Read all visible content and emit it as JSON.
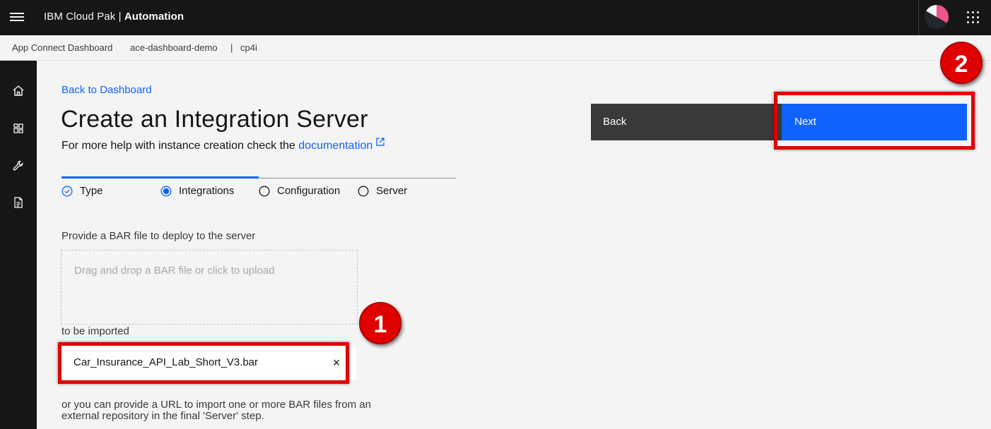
{
  "header": {
    "brand_light": "IBM Cloud Pak | ",
    "brand_bold": "Automation"
  },
  "breadcrumb": {
    "app": "App Connect Dashboard",
    "instance": "ace-dashboard-demo",
    "separator": "|",
    "namespace": "cp4i"
  },
  "main": {
    "back_link": "Back to Dashboard",
    "title": "Create an Integration Server",
    "help_prefix": "For more help with instance creation check the ",
    "help_link": "documentation",
    "steps": [
      {
        "label": "Type",
        "state": "complete"
      },
      {
        "label": "Integrations",
        "state": "current"
      },
      {
        "label": "Configuration",
        "state": "incomplete"
      },
      {
        "label": "Server",
        "state": "incomplete"
      }
    ],
    "bar_label": "Provide a BAR file to deploy to the server",
    "dropzone_text": "Drag and drop a BAR file or click to upload",
    "imported_label": "to be imported",
    "file_name": "Car_Insurance_API_Lab_Short_V3.bar",
    "file_close": "×",
    "url_text": "or you can provide a URL to import one or more BAR files from an external repository in the final 'Server' step."
  },
  "actions": {
    "back_label": "Back",
    "next_label": "Next"
  },
  "annotations": {
    "callout_1": "1",
    "callout_2": "2"
  },
  "colors": {
    "accent": "#0f62fe",
    "highlight": "#e00000",
    "header_bg": "#161616"
  }
}
